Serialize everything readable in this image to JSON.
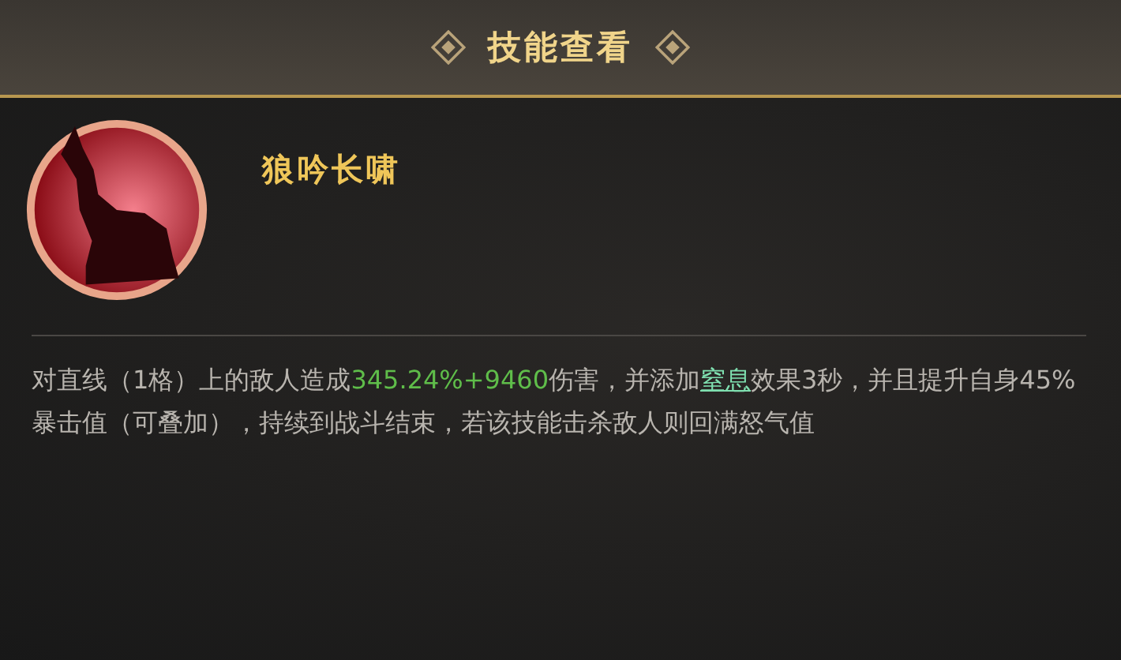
{
  "header": {
    "title": "技能查看"
  },
  "skill": {
    "name": "狼吟长啸",
    "description": [
      {
        "kind": "text",
        "text": "对直线（1格）上的敌人造成"
      },
      {
        "kind": "value",
        "text": "345.24%+9460"
      },
      {
        "kind": "text",
        "text": "伤害，并添加"
      },
      {
        "kind": "link",
        "text": "窒息"
      },
      {
        "kind": "text",
        "text": "效果3秒，并且提升自身45%暴击值（可叠加），持续到战斗结束，若该技能击杀敌人则回满怒气值"
      }
    ]
  }
}
